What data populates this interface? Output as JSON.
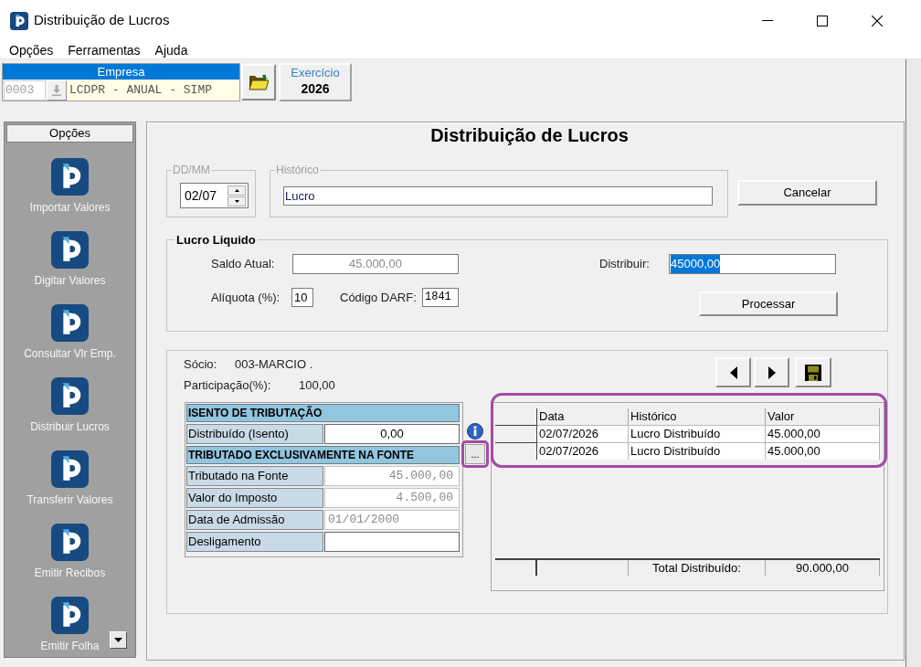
{
  "window": {
    "title": "Distribuição de Lucros"
  },
  "menu": [
    {
      "label": "Opções"
    },
    {
      "label": "Ferramentas"
    },
    {
      "label": "Ajuda"
    }
  ],
  "toolbar": {
    "empresa": {
      "label": "Empresa",
      "code": {
        "value": "0003",
        "disabled": true
      },
      "name": "LCDPR - ANUAL - SIMP"
    },
    "exercicio": {
      "label": "Exercício",
      "value": "2026"
    }
  },
  "sidebar": {
    "header": "Opções",
    "items": [
      {
        "label": "Importar Valores"
      },
      {
        "label": "Digitar Valores"
      },
      {
        "label": "Consultar Vlr Emp."
      },
      {
        "label": "Distribuir Lucros"
      },
      {
        "label": "Transferir Valores"
      },
      {
        "label": "Emitir Recibos"
      },
      {
        "label": "Emitir Folha"
      }
    ]
  },
  "form": {
    "title": "Distribuição de Lucros",
    "date": {
      "label": "DD/MM",
      "value": "02/07"
    },
    "historico": {
      "label": "Histórico",
      "value": "Lucro"
    },
    "cancel_button": "Cancelar",
    "lucro_liquido": {
      "title": "Lucro Liquido",
      "saldo_atual": {
        "label": "Saldo Atual:",
        "value": "45.000,00",
        "disabled": true
      },
      "distribuir": {
        "label": "Distribuir:",
        "value": "45000,00",
        "text_selected": true
      },
      "aliquota": {
        "label": "Alíquota (%):",
        "value": "10"
      },
      "codigo_darf": {
        "label": "Código DARF:",
        "value": "1841"
      },
      "process_button": "Processar"
    },
    "partner": {
      "socio": {
        "label": "Sócio:",
        "value": "003-MARCIO ."
      },
      "participacao": {
        "label": "Participação(%):",
        "value": "100,00"
      }
    },
    "tax_table": [
      {
        "kind": "header",
        "label": "ISENTO DE TRIBUTAÇÃO"
      },
      {
        "kind": "amount",
        "label": "Distribuído (Isento)",
        "value": "0,00",
        "disabled": false
      },
      {
        "kind": "header",
        "label": "TRIBUTADO EXCLUSIVAMENTE NA FONTE"
      },
      {
        "kind": "amount",
        "label": "Tributado na Fonte",
        "value": "45.000,00",
        "disabled": true
      },
      {
        "kind": "amount",
        "label": "Valor do Imposto",
        "value": "4.500,00",
        "disabled": true
      },
      {
        "kind": "date",
        "label": "Data de Admissão",
        "value": "01/01/2000",
        "disabled": true
      },
      {
        "kind": "date",
        "label": "Desligamento",
        "disabled": false
      }
    ],
    "details_button": {
      "label": "...",
      "highlighted": true
    },
    "grid": {
      "highlighted": true,
      "columns": [
        "Data",
        "Histórico",
        "Valor"
      ],
      "rows": [
        [
          "02/07/2026",
          "Lucro Distribuído",
          "45.000,00"
        ],
        [
          "02/07/2026",
          "Lucro Distribuído",
          "45.000,00"
        ]
      ],
      "total": {
        "label": "Total Distribuído:",
        "value": "90.000,00"
      }
    }
  }
}
